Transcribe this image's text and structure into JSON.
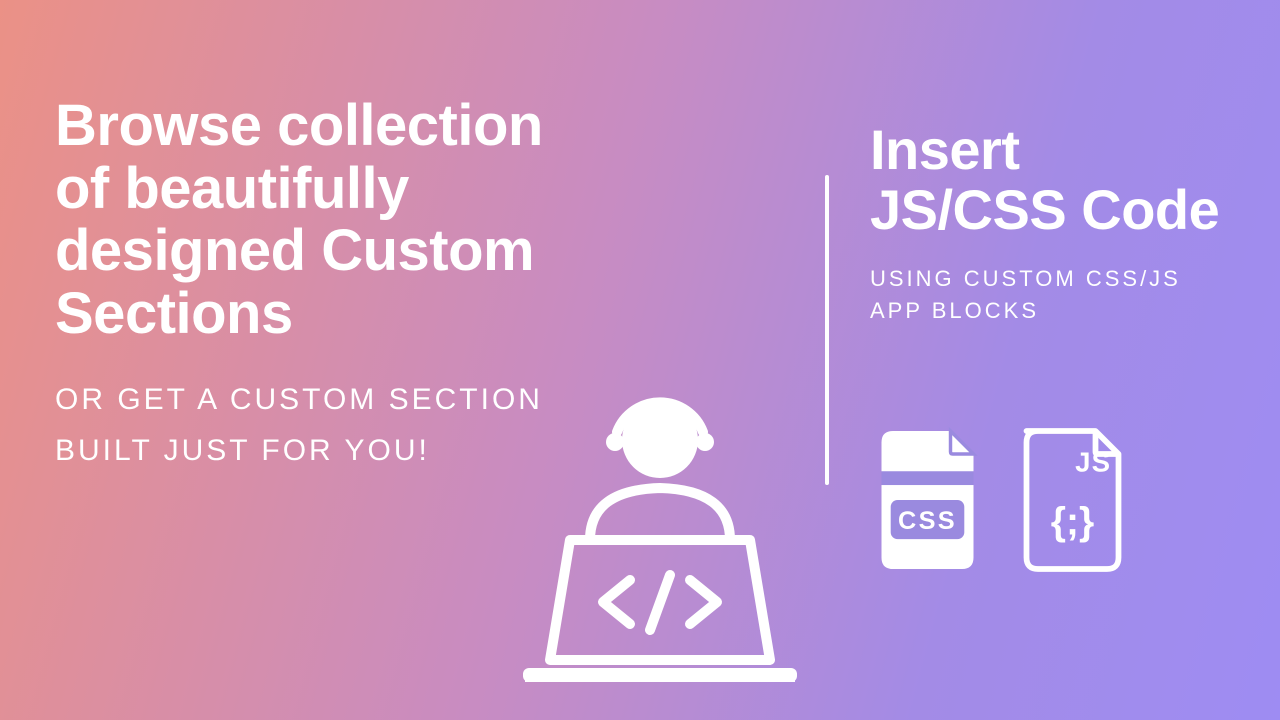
{
  "left": {
    "headline": "Browse collection of beautifully designed Custom Sections",
    "subhead": "OR GET A CUSTOM SECTION BUILT JUST FOR YOU!"
  },
  "right": {
    "headline": "Insert JS/CSS Code",
    "subhead": "USING CUSTOM CSS/JS APP BLOCKS"
  },
  "icons": {
    "css_label": "CSS",
    "js_label": "JS"
  },
  "colors": {
    "text": "#ffffff",
    "grad_start": "#eb9186",
    "grad_mid": "#c88cc2",
    "grad_end": "#9e8cf3"
  }
}
